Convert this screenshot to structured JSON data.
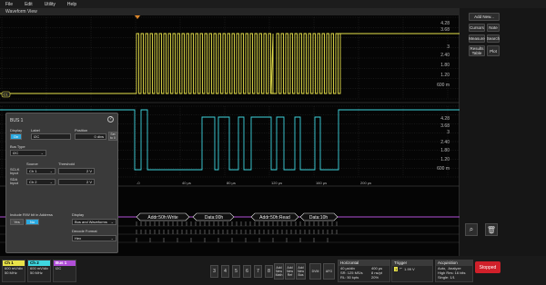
{
  "menu": [
    "File",
    "Edit",
    "Utility",
    "Help"
  ],
  "wave_title": "Waveform View",
  "ch1_scale": [
    "4.28",
    "3.68",
    "3",
    "2.40",
    "1.80",
    "1.20",
    "600 m"
  ],
  "ch2_scale": [
    "4.28",
    "3.68",
    "3",
    "2.40",
    "1.80",
    "1.20",
    "600 m"
  ],
  "time_ticks": [
    "-0",
    "40 µs",
    "80 µs",
    "120 µs",
    "160 µs",
    "200 µs"
  ],
  "decode": [
    {
      "text": "Addr:50h:Write"
    },
    {
      "text": "Data:00h"
    },
    {
      "text": "Addr:50h:Read"
    },
    {
      "text": "Data:10h"
    }
  ],
  "right_panel": {
    "add_new": "Add New...",
    "cursors": "Cursors",
    "note": "Note",
    "measure": "Measure",
    "search": "Search",
    "results_table": "Results Table",
    "plot": "Plot"
  },
  "bus_dialog": {
    "title": "BUS 1",
    "display_label": "Display",
    "display_value": "On",
    "label_label": "Label",
    "label_value": "I2C",
    "position_label": "Position",
    "position_value": "0 divs",
    "set_to_0": "Set to 0",
    "bus_type_label": "Bus Type",
    "bus_type_value": "I2C",
    "source_label": "Source",
    "threshold_label": "Threshold",
    "scl_label": "SCLK Input",
    "scl_source": "Ch 1",
    "scl_threshold": "2 V",
    "sda_label": "SDA Input",
    "sda_source": "Ch 2",
    "sda_threshold": "2 V",
    "rw_label": "Include R/W bit in Address",
    "yes": "Yes",
    "no": "No",
    "display2_label": "Display",
    "display2_value": "Bus and Waveforms",
    "decode_label": "Decode Format",
    "decode_value": "Hex"
  },
  "bottom": {
    "ch1": {
      "name": "Ch 1",
      "l1": "600 mV/div",
      "l2": "50 MHz"
    },
    "ch2": {
      "name": "Ch 2",
      "l1": "600 mV/div",
      "l2": "50 MHz"
    },
    "bus1": {
      "name": "Bus 1",
      "l1": "I2C"
    },
    "nums": [
      "3",
      "4",
      "5",
      "6",
      "7",
      "8"
    ],
    "add_math": "Add New Math",
    "add_ref": "Add New Ref",
    "add_bus": "Add New Bus",
    "dvm": "DVM",
    "afg": "AFG",
    "horizontal": {
      "title": "Horizontal",
      "l1": "40 µs/div",
      "l2": "SR: 125 MS/s",
      "l3": "RL: 50 kpts",
      "r1": "400 µs",
      "r2": "8 ns/pt",
      "r3": "20%"
    },
    "trigger": {
      "title": "Trigger",
      "src": "1",
      "level": "1.99 V"
    },
    "acquisition": {
      "title": "Acquisition",
      "l1": "Auto,",
      "l2": "Analyze",
      "l3": "High Res: 16 bits",
      "l4": "Single: 1/1"
    },
    "stop": "Stopped"
  },
  "colors": {
    "ch1": "#e8e24a",
    "ch2": "#3fd6e0",
    "bus": "#b14fd8",
    "accent": "#2aa9e0"
  }
}
